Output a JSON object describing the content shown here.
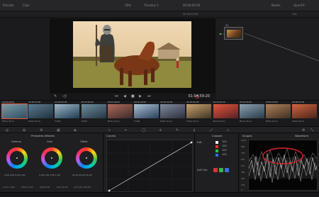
{
  "topbar": {
    "project": "Presidio",
    "clips_label": "Clips",
    "zoom": "39%",
    "timeline_name": "Timeline 1",
    "timecode_right": "00:00:00:00",
    "nodes_label": "Nodes",
    "lightbox_label": "OpenFX"
  },
  "secondbar": {
    "left_time": "00:00:00:00",
    "right_label": "Clip"
  },
  "viewer": {
    "timecode": "01:04:59:20"
  },
  "nodes": {
    "node1_num": "01"
  },
  "clips": [
    {
      "tc": "00:00:00:00",
      "name": "Photo (P+C)"
    },
    {
      "tc": "00:00:00:00",
      "name": "Photo (P+C)"
    },
    {
      "tc": "00:00:00:00",
      "name": "H.264"
    },
    {
      "tc": "00:00:00:00",
      "name": "H.264"
    },
    {
      "tc": "00:00:00:00",
      "name": "Photo (P+C)"
    },
    {
      "tc": "00:00:00:00",
      "name": "H.264"
    },
    {
      "tc": "00:00:00:00",
      "name": "Photo (P+C)"
    },
    {
      "tc": "00:00:00:00",
      "name": "Photo (P+C)"
    },
    {
      "tc": "00:00:00:00",
      "name": "Photo (P+C)"
    },
    {
      "tc": "00:00:00:00",
      "name": "Photo (P+C)"
    },
    {
      "tc": "00:00:00:00",
      "name": "Photo (P+C)"
    },
    {
      "tc": "00:00:00:00",
      "name": "Photo (P+C)"
    }
  ],
  "primaries": {
    "title": "Primaries Wheels",
    "wheels": [
      {
        "label": "Gamma",
        "vals": "0.00  0.00  0.00  0.00"
      },
      {
        "label": "Gain",
        "vals": "1.00  1.00  1.00  1.00"
      },
      {
        "label": "Offset",
        "vals": "25.00  25.00  25.00"
      }
    ],
    "bottom": {
      "contrast": "Cont  1.000",
      "pivot": "Pivot  0.435",
      "sat": "Sat  50.00",
      "hue": "Hue  50.00",
      "lum": "Lum Mix  100.00"
    }
  },
  "curves": {
    "title": "Curves"
  },
  "custom": {
    "title": "Custom",
    "edit_label": "Edit",
    "rows": [
      "100",
      "100",
      "100",
      "100"
    ],
    "soft_clip": "Soft Clip"
  },
  "scopes": {
    "title": "Scopes",
    "mode": "Waveform",
    "scale": [
      "1023",
      "896",
      "768",
      "640",
      "512",
      "384",
      "256",
      "128",
      "0"
    ]
  },
  "colors": {
    "accent": "#e0583c",
    "annotation": "#e0202a"
  }
}
